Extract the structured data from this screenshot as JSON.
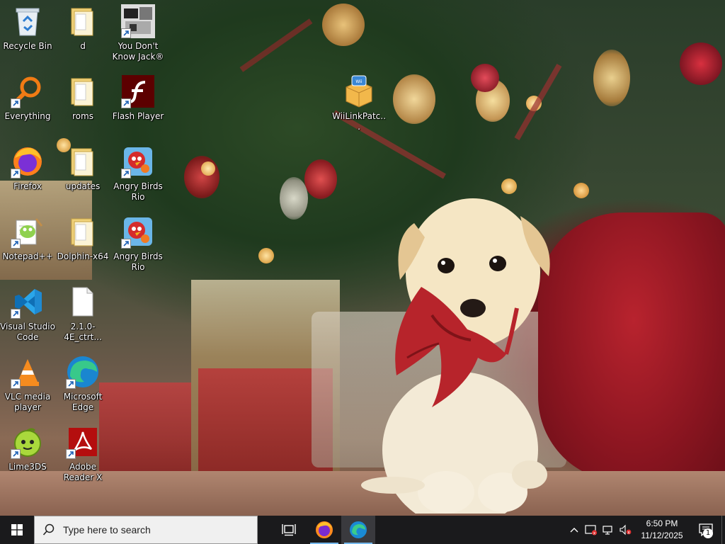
{
  "desktop_icons": [
    {
      "label": "Recycle Bin",
      "icon": "recycle-bin-icon"
    },
    {
      "label": "d",
      "icon": "folder-icon"
    },
    {
      "label": "You Don't Know Jack®",
      "icon": "game-icon"
    },
    {
      "label": "Everything",
      "icon": "everything-search-icon"
    },
    {
      "label": "roms",
      "icon": "folder-icon"
    },
    {
      "label": "Flash Player",
      "icon": "flash-player-icon"
    },
    {
      "label": "Firefox",
      "icon": "firefox-icon"
    },
    {
      "label": "updates",
      "icon": "folder-icon"
    },
    {
      "label": "Angry Birds Rio",
      "icon": "angry-birds-icon"
    },
    {
      "label": "Notepad++",
      "icon": "notepadpp-icon"
    },
    {
      "label": "Dolphin-x64",
      "icon": "folder-icon"
    },
    {
      "label": "Angry Birds Rio",
      "icon": "angry-birds-icon"
    },
    {
      "label": "Visual Studio Code",
      "icon": "vscode-icon"
    },
    {
      "label": "2.1.0-4E_ctrt...",
      "icon": "file-icon"
    },
    {
      "label": "VLC media player",
      "icon": "vlc-icon"
    },
    {
      "label": "Microsoft Edge",
      "icon": "edge-icon"
    },
    {
      "label": "Lime3DS",
      "icon": "lime3ds-icon"
    },
    {
      "label": "Adobe Reader X",
      "icon": "adobe-reader-icon"
    },
    {
      "label": "WiiLinkPatc...",
      "icon": "package-icon"
    }
  ],
  "taskbar": {
    "search_placeholder": "Type here to search",
    "pinned": [
      {
        "name": "task-view",
        "icon": "task-view-icon"
      },
      {
        "name": "firefox",
        "icon": "firefox-icon"
      },
      {
        "name": "edge",
        "icon": "edge-icon"
      }
    ],
    "time": "6:50 PM",
    "date": "11/12/2025",
    "notification_count": "1"
  },
  "colors": {
    "taskbar_bg": "#1a1a1c",
    "accent": "#76b9ed",
    "desktop_text": "#ffffff"
  }
}
